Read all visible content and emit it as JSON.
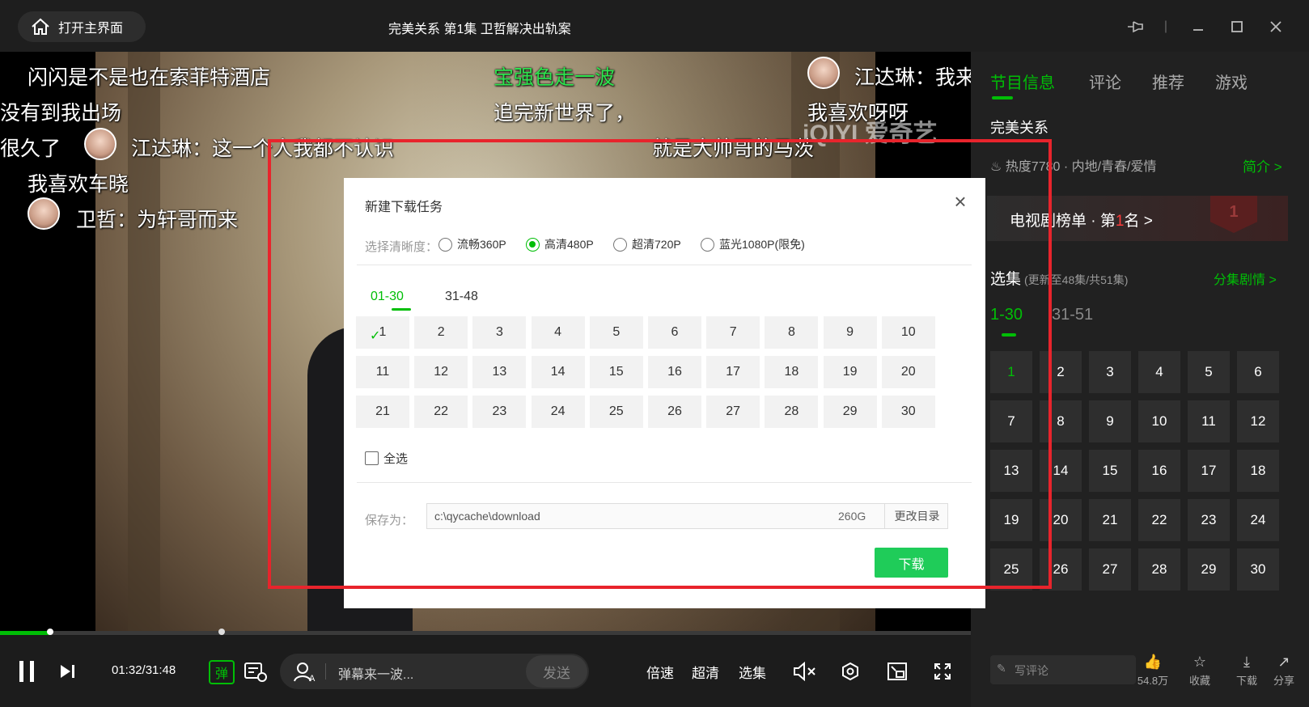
{
  "topbar": {
    "home_label": "打开主界面",
    "title": "完美关系 第1集 卫哲解决出轨案"
  },
  "video": {
    "danmaku": [
      {
        "text": "闪闪是不是也在索菲特酒店",
        "color": "white"
      },
      {
        "text": "宝强色走一波",
        "color": "green"
      },
      {
        "text": "江达琳：我来",
        "color": "white"
      },
      {
        "text": "没有到我出场",
        "color": "white"
      },
      {
        "text": "追完新世界了，",
        "color": "white"
      },
      {
        "text": "我喜欢呀呀",
        "color": "white"
      },
      {
        "text": "很久了",
        "color": "white"
      },
      {
        "text": "江达琳：这一个人我都不认识",
        "color": "white"
      },
      {
        "text": "就是大帅哥的马茨",
        "color": "white"
      },
      {
        "text": "我喜欢车晓",
        "color": "white"
      },
      {
        "text": "卫哲：为轩哥而来",
        "color": "white"
      }
    ],
    "watermark": "iQIYI 爱奇艺",
    "progress_fraction": 0.052
  },
  "controls": {
    "time": "01:32/31:48",
    "danmaku_toggle": "弹",
    "danmaku_placeholder": "弹幕来一波...",
    "send": "发送",
    "speed": "倍速",
    "quality": "超清",
    "episodes": "选集"
  },
  "panel": {
    "tabs": [
      "节目信息",
      "评论",
      "推荐",
      "游戏"
    ],
    "show_title": "完美关系",
    "meta": "热度7780 · 内地/青春/爱情",
    "intro": "简介 >",
    "rank_prefix": "电视剧榜单 · 第",
    "rank_num": "1",
    "rank_suffix": "名 >",
    "rank_badge": "1",
    "episodes_title": "选集",
    "episodes_sub": "(更新至48集/共51集)",
    "plot_link": "分集剧情 >",
    "ranges": [
      "1-30",
      "31-51"
    ],
    "episodes": [
      "1",
      "2",
      "3",
      "4",
      "5",
      "6",
      "7",
      "8",
      "9",
      "10",
      "11",
      "12",
      "13",
      "14",
      "15",
      "16",
      "17",
      "18",
      "19",
      "20",
      "21",
      "22",
      "23",
      "24",
      "25",
      "26",
      "27",
      "28",
      "29",
      "30"
    ],
    "comment_placeholder": "写评论",
    "actions": [
      {
        "label": "54.8万",
        "icon": "like-icon"
      },
      {
        "label": "收藏",
        "icon": "favorite-icon"
      },
      {
        "label": "下载",
        "icon": "download-icon"
      },
      {
        "label": "分享",
        "icon": "share-icon"
      }
    ]
  },
  "dialog": {
    "title": "新建下载任务",
    "quality_label": "选择清晰度：",
    "qualities": [
      "流畅360P",
      "高清480P",
      "超清720P",
      "蓝光1080P(限免)"
    ],
    "selected_quality": "高清480P",
    "ranges": [
      "01-30",
      "31-48"
    ],
    "episodes": [
      "1",
      "2",
      "3",
      "4",
      "5",
      "6",
      "7",
      "8",
      "9",
      "10",
      "11",
      "12",
      "13",
      "14",
      "15",
      "16",
      "17",
      "18",
      "19",
      "20",
      "21",
      "22",
      "23",
      "24",
      "25",
      "26",
      "27",
      "28",
      "29",
      "30"
    ],
    "select_all": "全选",
    "save_label": "保存为：",
    "save_path": "c:\\qycache\\download",
    "free_space": "260G",
    "change_dir": "更改目录",
    "download": "下载"
  },
  "colors": {
    "accent": "#00be06",
    "download_button": "#1fcc59",
    "highlight_border": "#e8242c"
  }
}
